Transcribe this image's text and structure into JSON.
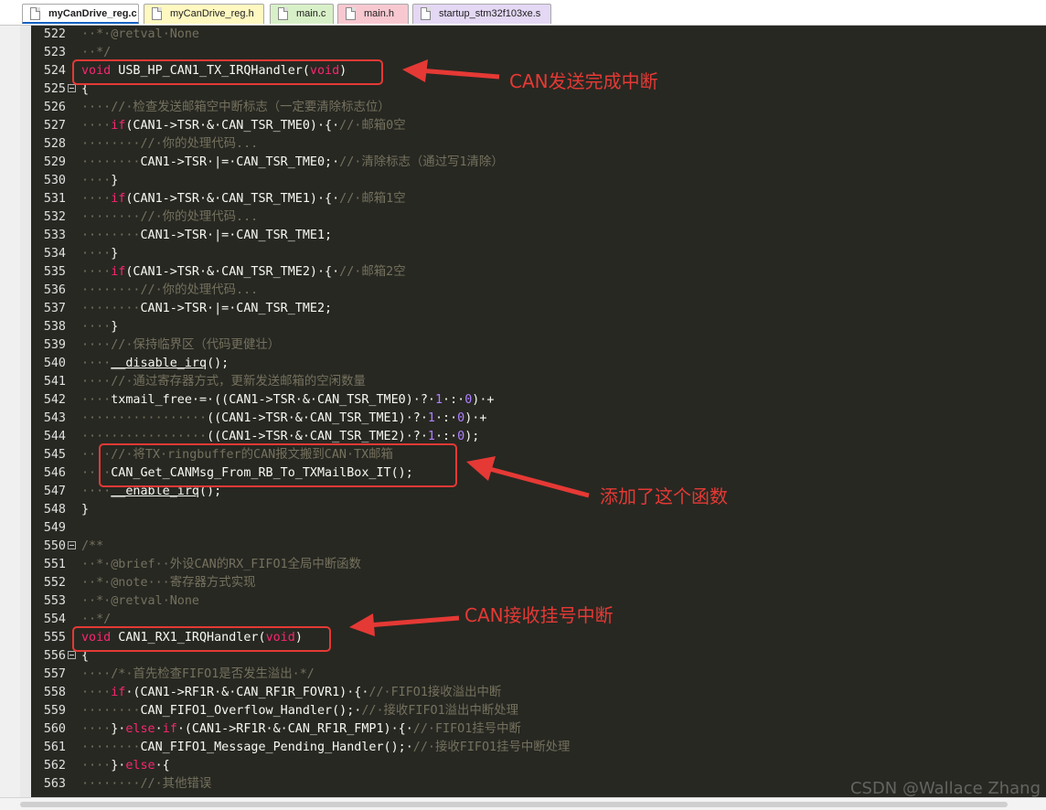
{
  "tabs": [
    {
      "label": "myCanDrive_reg.c",
      "color": "#ffffff",
      "active": true
    },
    {
      "label": "myCanDrive_reg.h",
      "color": "#fff8c0"
    },
    {
      "label": "main.c",
      "color": "#d8f0c8"
    },
    {
      "label": "main.h",
      "color": "#f8c8d0"
    },
    {
      "label": "startup_stm32f103xe.s",
      "color": "#e4d8f4"
    }
  ],
  "lines": [
    {
      "n": "522",
      "fold": false,
      "html": "<span class='cm'>··*·</span><span class='tag'>@retval</span><span class='cm'>·None</span>"
    },
    {
      "n": "523",
      "fold": false,
      "html": "<span class='cm'>··*/</span>"
    },
    {
      "n": "524",
      "fold": false,
      "html": "<span class='kw'>void</span> USB_HP_CAN1_TX_IRQHandler(<span class='kw'>void</span>)"
    },
    {
      "n": "525",
      "fold": true,
      "html": "{"
    },
    {
      "n": "526",
      "fold": false,
      "html": "<span class='cm'>····//·检查发送邮箱空中断标志（一定要清除标志位）</span>"
    },
    {
      "n": "527",
      "fold": false,
      "html": "<span class='cm'>····</span><span class='kw'>if</span>(CAN1-&gt;TSR·&amp;·CAN_TSR_TME0)·{·<span class='cm'>//·邮箱0空</span>"
    },
    {
      "n": "528",
      "fold": false,
      "html": "<span class='cm'>········//·你的处理代码...</span>"
    },
    {
      "n": "529",
      "fold": false,
      "html": "<span class='cm'>········</span>CAN1-&gt;TSR·|=·CAN_TSR_TME0;·<span class='cm'>//·清除标志（通过写1清除）</span>"
    },
    {
      "n": "530",
      "fold": false,
      "html": "<span class='cm'>····</span>}"
    },
    {
      "n": "531",
      "fold": false,
      "html": "<span class='cm'>····</span><span class='kw'>if</span>(CAN1-&gt;TSR·&amp;·CAN_TSR_TME1)·{·<span class='cm'>//·邮箱1空</span>"
    },
    {
      "n": "532",
      "fold": false,
      "html": "<span class='cm'>········//·你的处理代码...</span>"
    },
    {
      "n": "533",
      "fold": false,
      "html": "<span class='cm'>········</span>CAN1-&gt;TSR·|=·CAN_TSR_TME1;"
    },
    {
      "n": "534",
      "fold": false,
      "html": "<span class='cm'>····</span>}"
    },
    {
      "n": "535",
      "fold": false,
      "html": "<span class='cm'>····</span><span class='kw'>if</span>(CAN1-&gt;TSR·&amp;·CAN_TSR_TME2)·{·<span class='cm'>//·邮箱2空</span>"
    },
    {
      "n": "536",
      "fold": false,
      "html": "<span class='cm'>········//·你的处理代码...</span>"
    },
    {
      "n": "537",
      "fold": false,
      "html": "<span class='cm'>········</span>CAN1-&gt;TSR·|=·CAN_TSR_TME2;"
    },
    {
      "n": "538",
      "fold": false,
      "html": "<span class='cm'>····</span>}"
    },
    {
      "n": "539",
      "fold": false,
      "html": "<span class='cm'>····//·保持临界区（代码更健壮）</span>"
    },
    {
      "n": "540",
      "fold": false,
      "html": "<span class='cm'>····</span><u>__disable_irq</u>();"
    },
    {
      "n": "541",
      "fold": false,
      "html": "<span class='cm'>····//·通过寄存器方式，更新发送邮箱的空闲数量</span>"
    },
    {
      "n": "542",
      "fold": false,
      "html": "<span class='cm'>····</span>txmail_free·=·((CAN1-&gt;TSR·&amp;·CAN_TSR_TME0)·?·<span class='num'>1</span>·:·<span class='num'>0</span>)·+"
    },
    {
      "n": "543",
      "fold": false,
      "html": "<span class='cm'>·················</span>((CAN1-&gt;TSR·&amp;·CAN_TSR_TME1)·?·<span class='num'>1</span>·:·<span class='num'>0</span>)·+"
    },
    {
      "n": "544",
      "fold": false,
      "html": "<span class='cm'>·················</span>((CAN1-&gt;TSR·&amp;·CAN_TSR_TME2)·?·<span class='num'>1</span>·:·<span class='num'>0</span>);"
    },
    {
      "n": "545",
      "fold": false,
      "html": "<span class='cm'>····//·将TX·ringbuffer的CAN报文搬到CAN·TX邮箱</span>"
    },
    {
      "n": "546",
      "fold": false,
      "html": "<span class='cm'>····</span>CAN_Get_CANMsg_From_RB_To_TXMailBox_IT();"
    },
    {
      "n": "547",
      "fold": false,
      "html": "<span class='cm'>····</span><u>__enable_irq</u>();"
    },
    {
      "n": "548",
      "fold": false,
      "html": "}"
    },
    {
      "n": "549",
      "fold": false,
      "html": ""
    },
    {
      "n": "550",
      "fold": true,
      "html": "<span class='cm'>/**</span>"
    },
    {
      "n": "551",
      "fold": false,
      "html": "<span class='cm'>··*·</span><span class='tag'>@brief</span><span class='cm'>··外设CAN的RX_FIFO1全局中断函数</span>"
    },
    {
      "n": "552",
      "fold": false,
      "html": "<span class='cm'>··*·</span><span class='tag'>@note</span><span class='cm'>···寄存器方式实现</span>"
    },
    {
      "n": "553",
      "fold": false,
      "html": "<span class='cm'>··*·</span><span class='tag'>@retval</span><span class='cm'>·None</span>"
    },
    {
      "n": "554",
      "fold": false,
      "html": "<span class='cm'>··*/</span>"
    },
    {
      "n": "555",
      "fold": false,
      "html": "<span class='kw'>void</span> CAN1_RX1_IRQHandler(<span class='kw'>void</span>)"
    },
    {
      "n": "556",
      "fold": true,
      "html": "{"
    },
    {
      "n": "557",
      "fold": false,
      "html": "<span class='cm'>····/*·首先检查FIFO1是否发生溢出·*/</span>"
    },
    {
      "n": "558",
      "fold": false,
      "html": "<span class='cm'>····</span><span class='kw'>if</span>·(CAN1-&gt;RF1R·&amp;·CAN_RF1R_FOVR1)·{·<span class='cm'>//·FIFO1接收溢出中断</span>"
    },
    {
      "n": "559",
      "fold": false,
      "html": "<span class='cm'>········</span>CAN_FIFO1_Overflow_Handler();·<span class='cm'>//·接收FIFO1溢出中断处理</span>"
    },
    {
      "n": "560",
      "fold": false,
      "html": "<span class='cm'>····</span>}·<span class='kw'>else</span>·<span class='kw'>if</span>·(CAN1-&gt;RF1R·&amp;·CAN_RF1R_FMP1)·{·<span class='cm'>//·FIFO1挂号中断</span>"
    },
    {
      "n": "561",
      "fold": false,
      "html": "<span class='cm'>········</span>CAN_FIFO1_Message_Pending_Handler();·<span class='cm'>//·接收FIFO1挂号中断处理</span>"
    },
    {
      "n": "562",
      "fold": false,
      "html": "<span class='cm'>····</span>}·<span class='kw'>else</span>·{"
    },
    {
      "n": "563",
      "fold": false,
      "html": "<span class='cm'>········//·其他错误</span>"
    }
  ],
  "annotations": {
    "tx_done": "CAN发送完成中断",
    "added_func": "添加了这个函数",
    "rx_pending": "CAN接收挂号中断"
  },
  "watermark": "CSDN @Wallace Zhang"
}
